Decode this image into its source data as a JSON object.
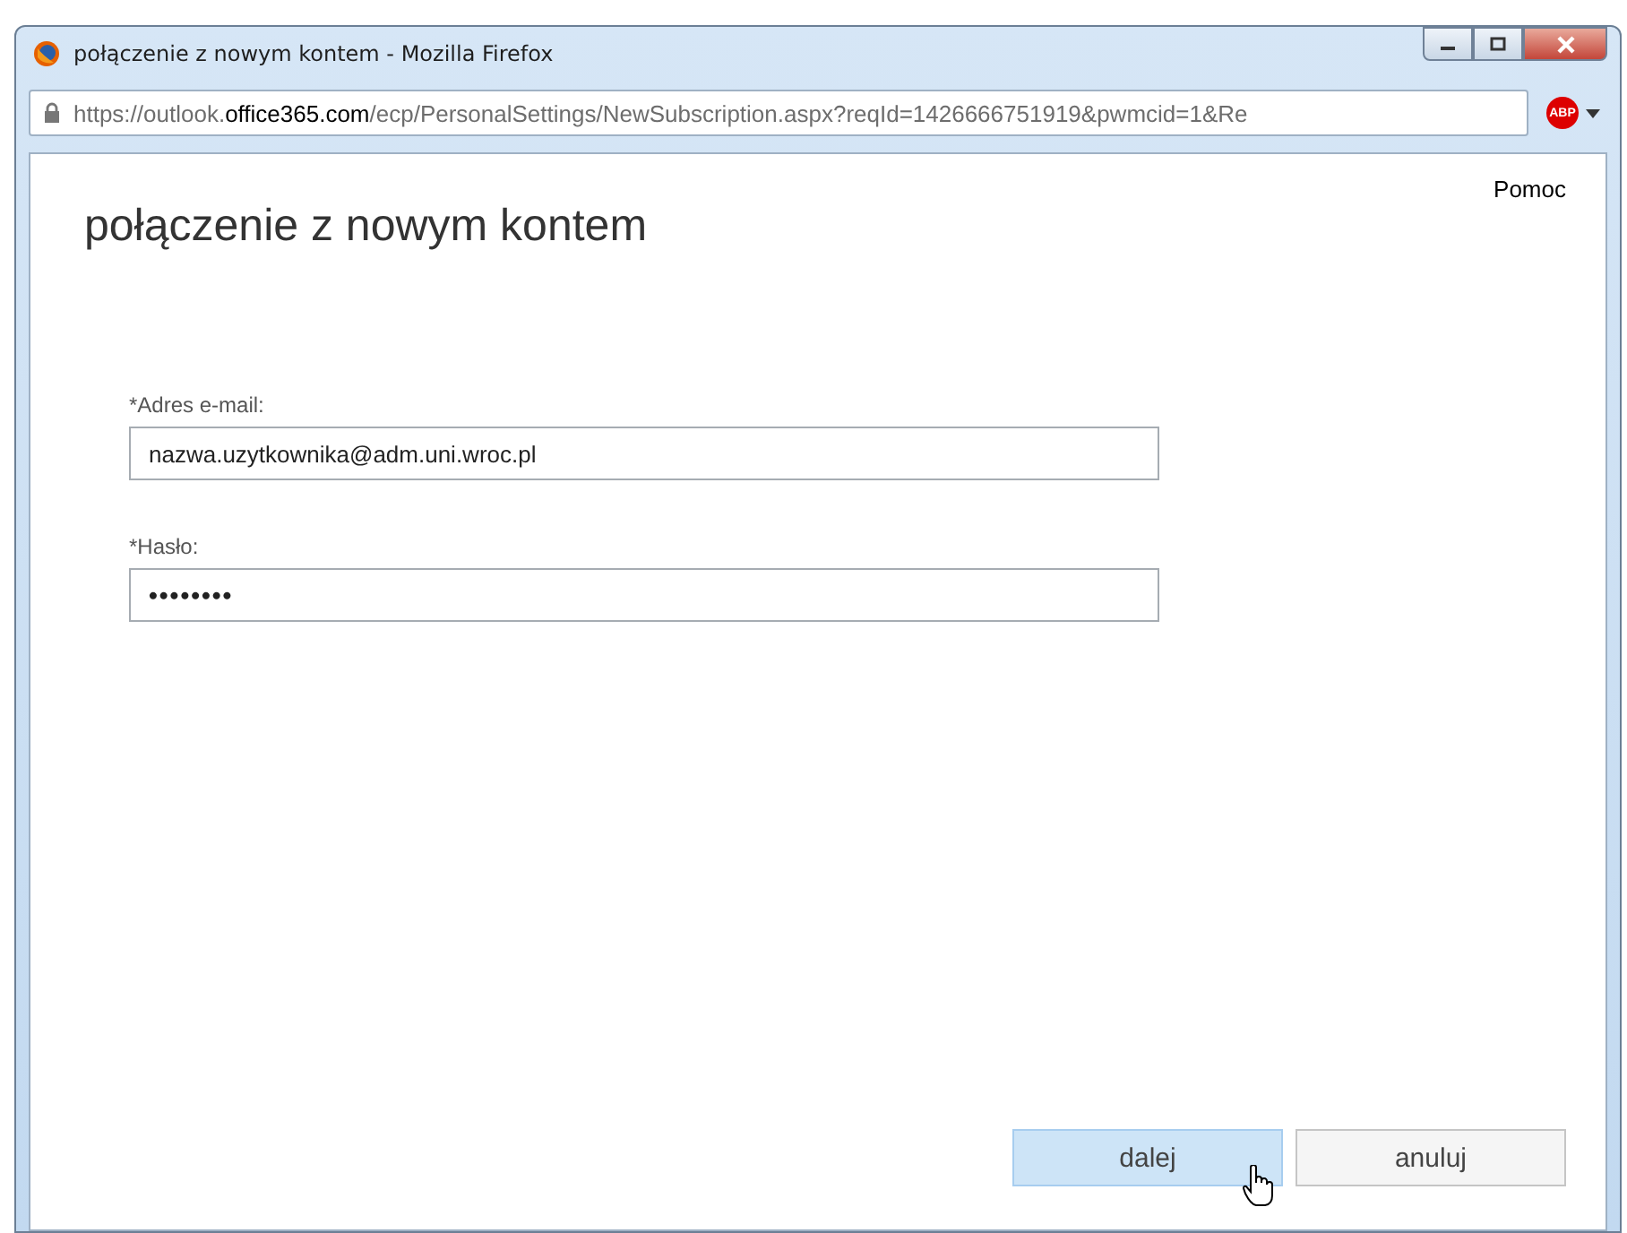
{
  "window": {
    "title": "połączenie z nowym kontem - Mozilla Firefox"
  },
  "address_bar": {
    "url_prefix": "https://outlook.",
    "url_domain": "office365.com",
    "url_rest": "/ecp/PersonalSettings/NewSubscription.aspx?reqId=1426666751919&pwmcid=1&Re",
    "addon_badge": "ABP"
  },
  "page": {
    "heading": "połączenie z nowym kontem",
    "help_link": "Pomoc",
    "fields": [
      {
        "label": "*Adres e-mail:",
        "value": "nazwa.uzytkownika@adm.uni.wroc.pl",
        "kind": "text"
      },
      {
        "label": "*Hasło:",
        "value": "••••••••",
        "kind": "password"
      }
    ],
    "buttons": [
      {
        "label": "dalej",
        "hovered": true
      },
      {
        "label": "anuluj",
        "hovered": false
      }
    ]
  }
}
